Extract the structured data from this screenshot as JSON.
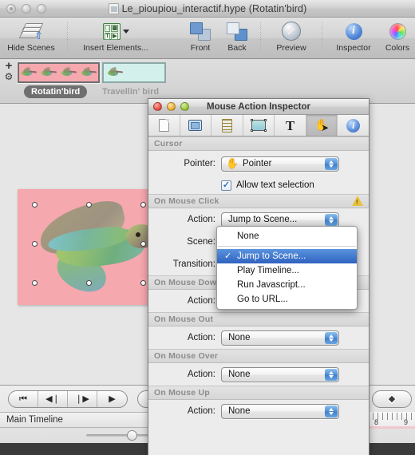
{
  "window": {
    "title": "Le_pioupiou_interactif.hype (Rotatin'bird)",
    "doc_icon": "document-icon",
    "lights": [
      "close-button",
      "minimize-button",
      "zoom-button"
    ]
  },
  "toolbar": {
    "items": [
      {
        "label": "Hide Scenes",
        "icon": "hide-scenes-icon"
      },
      {
        "label": "Insert Elements...",
        "icon": "insert-elements-icon"
      },
      {
        "label": "Front",
        "icon": "bring-front-icon"
      },
      {
        "label": "Back",
        "icon": "send-back-icon"
      },
      {
        "label": "Preview",
        "icon": "preview-compass-icon"
      },
      {
        "label": "Inspector",
        "icon": "inspector-info-icon"
      },
      {
        "label": "Colors",
        "icon": "colors-wheel-icon"
      }
    ]
  },
  "scenes": {
    "add_label": "+",
    "gear_label": "⚙",
    "items": [
      {
        "name": "Rotatin'bird",
        "selected": true
      },
      {
        "name": "Travellin' bird",
        "selected": false
      }
    ]
  },
  "canvas": {
    "stage_color": "#f5a8ae",
    "element_name": "hummingbird-element",
    "handles": 8
  },
  "timeline": {
    "transport": [
      {
        "name": "go-to-start-button",
        "glyph": "⏮"
      },
      {
        "name": "step-back-button",
        "glyph": "◀❘"
      },
      {
        "name": "step-forward-button",
        "glyph": "❘▶"
      },
      {
        "name": "play-button",
        "glyph": "▶"
      }
    ],
    "loop_glyph": "⇄",
    "keyframe_glyph": "◆",
    "label": "Main Timeline",
    "ruler_ticks": [
      "8",
      "9"
    ],
    "zoom_value": 43
  },
  "inspector": {
    "title": "Mouse Action Inspector",
    "lights": [
      "close-button",
      "minimize-button",
      "zoom-button"
    ],
    "tabs": [
      {
        "name": "document-tab",
        "icon": "document-icon",
        "active": false
      },
      {
        "name": "scene-tab",
        "icon": "scene-icon",
        "active": false
      },
      {
        "name": "metrics-tab",
        "icon": "ruler-icon",
        "active": false
      },
      {
        "name": "element-tab",
        "icon": "element-icon",
        "active": false
      },
      {
        "name": "typography-tab",
        "icon": "text-T-icon",
        "active": false
      },
      {
        "name": "mouse-action-tab",
        "icon": "mouse-pointer-icon",
        "active": true
      },
      {
        "name": "info-tab",
        "icon": "info-icon",
        "active": false
      }
    ],
    "sections": [
      {
        "heading": "Cursor",
        "warning": false,
        "rows": [
          {
            "label": "Pointer:",
            "value": "Pointer",
            "control": "popup-button",
            "cursor_icon": "hand-cursor-icon"
          }
        ],
        "checkbox": {
          "label": "Allow text selection",
          "checked": true
        }
      },
      {
        "heading": "On Mouse Click",
        "warning": true,
        "rows": [
          {
            "label": "Action:",
            "value": "Jump to Scene...",
            "control": "popup-button"
          },
          {
            "label": "Scene:",
            "value": "",
            "control": "popup-button"
          },
          {
            "label": "Transition:",
            "value": "",
            "control": "popup-button"
          }
        ]
      },
      {
        "heading": "On Mouse Down",
        "warning": false,
        "rows": [
          {
            "label": "Action:",
            "value": "None",
            "control": "popup-button"
          }
        ]
      },
      {
        "heading": "On Mouse Out",
        "warning": false,
        "rows": [
          {
            "label": "Action:",
            "value": "None",
            "control": "popup-button"
          }
        ]
      },
      {
        "heading": "On Mouse Over",
        "warning": false,
        "rows": [
          {
            "label": "Action:",
            "value": "None",
            "control": "popup-button"
          }
        ]
      },
      {
        "heading": "On Mouse Up",
        "warning": false,
        "rows": [
          {
            "label": "Action:",
            "value": "None",
            "control": "popup-button"
          }
        ]
      }
    ]
  },
  "action_menu": {
    "open": true,
    "items": [
      {
        "label": "None",
        "selected": false,
        "checked": false
      },
      {
        "label": "Jump to Scene...",
        "selected": true,
        "checked": true
      },
      {
        "label": "Play Timeline...",
        "selected": false,
        "checked": false
      },
      {
        "label": "Run Javascript...",
        "selected": false,
        "checked": false
      },
      {
        "label": "Go to URL...",
        "selected": false,
        "checked": false
      }
    ],
    "check_glyph": "✓",
    "highlight_color": "#3b6ecc"
  }
}
